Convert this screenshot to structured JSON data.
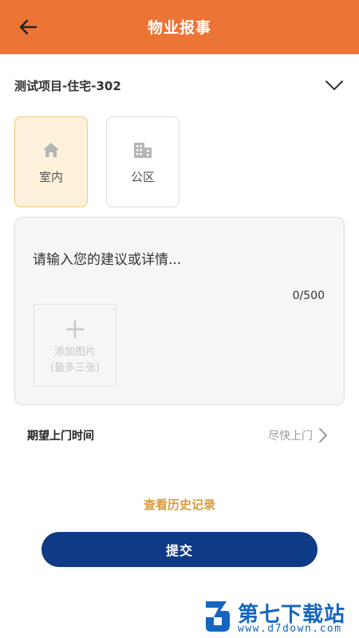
{
  "header": {
    "title": "物业报事",
    "back_icon": "arrow-left-icon"
  },
  "project": {
    "name": "测试项目-住宅-302",
    "dropdown_icon": "chevron-down-icon"
  },
  "categories": [
    {
      "label": "室内",
      "icon": "home-icon",
      "selected": true
    },
    {
      "label": "公区",
      "icon": "building-icon",
      "selected": false
    }
  ],
  "description": {
    "placeholder": "请输入您的建议或详情...",
    "counter": "0/500",
    "add_photo_line1": "添加图片",
    "add_photo_line2": "(最多三张)"
  },
  "visit_time": {
    "label": "期望上门时间",
    "value": "尽快上门"
  },
  "history_link": "查看历史记录",
  "submit_label": "提交",
  "watermark": {
    "title": "第七下载站",
    "url": "www.d7down.com"
  },
  "colors": {
    "header": "#EC7434",
    "selected_tile_bg": "#FDF1DC",
    "selected_tile_border": "#F2C770",
    "submit": "#0E3A86",
    "history_link": "#DB9A3B",
    "watermark": "#1565C0"
  }
}
